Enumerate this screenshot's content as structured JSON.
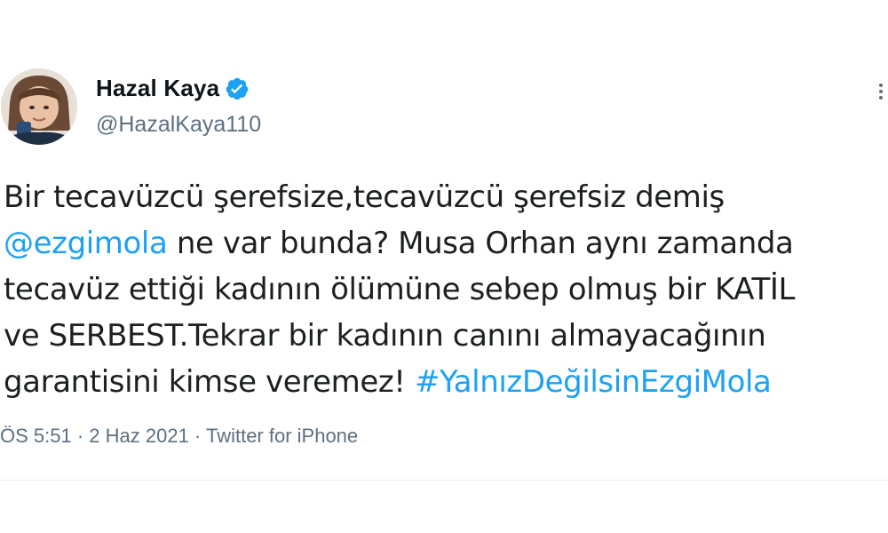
{
  "author": {
    "display_name": "Hazal Kaya",
    "handle": "@HazalKaya110",
    "verified": true
  },
  "tweet": {
    "line1": "Bir tecavüzcü şerefsize,tecavüzcü şerefsiz demiş",
    "mention": "@ezgimola",
    "line2_rest": " ne var bunda? Musa Orhan aynı zamanda",
    "line3": "tecavüz ettiği kadının ölümüne sebep olmuş bir KATİL",
    "line4": "ve SERBEST.Tekrar bir kadının canını almayacağının",
    "line5_text": "garantisini kimse veremez! ",
    "hashtag": "#YalnızDeğilsinEzgiMola"
  },
  "meta": {
    "time": "ÖS 5:51",
    "sep1": " · ",
    "date": "2 Haz 2021",
    "sep2": " · ",
    "source": "Twitter for iPhone"
  },
  "colors": {
    "link": "#1da1f2",
    "text": "#1c2022",
    "muted": "#5b7083",
    "verified": "#1da1f2"
  },
  "icons": {
    "verified": "verified-badge-icon",
    "more": "more-options-icon"
  }
}
